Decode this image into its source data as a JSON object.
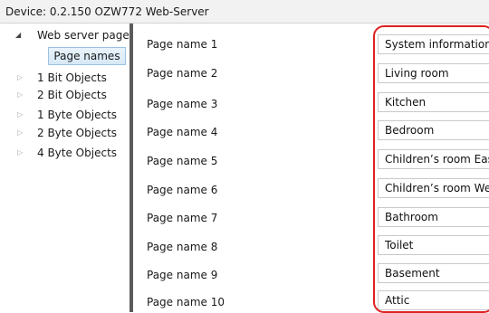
{
  "window": {
    "title": "Device: 0.2.150  OZW772 Web-Server"
  },
  "tree": {
    "root": {
      "label": "Web server pages",
      "arrow": "◢",
      "selected_child": "Page names"
    },
    "items": [
      {
        "label": "1 Bit Objects",
        "arrow": "▷"
      },
      {
        "label": "2 Bit Objects",
        "arrow": "▷"
      },
      {
        "label": "1 Byte Objects",
        "arrow": "▷"
      },
      {
        "label": "2 Byte Objects",
        "arrow": "▷"
      },
      {
        "label": "4 Byte Objects",
        "arrow": "▷"
      }
    ]
  },
  "pages": [
    {
      "label": "Page name 1",
      "value": "System information"
    },
    {
      "label": "Page name 2",
      "value": "Living room"
    },
    {
      "label": "Page name 3",
      "value": "Kitchen"
    },
    {
      "label": "Page name 4",
      "value": "Bedroom"
    },
    {
      "label": "Page name 5",
      "value": "Children’s room East"
    },
    {
      "label": "Page name 6",
      "value": "Children’s room West"
    },
    {
      "label": "Page name 7",
      "value": "Bathroom"
    },
    {
      "label": "Page name 8",
      "value": "Toilet"
    },
    {
      "label": "Page name 9",
      "value": "Basement"
    },
    {
      "label": "Page name 10",
      "value": "Attic"
    }
  ],
  "colors": {
    "highlight": "#e02020",
    "splitter": "#5b5b5b",
    "selected_bg": "#d6e8f6"
  }
}
